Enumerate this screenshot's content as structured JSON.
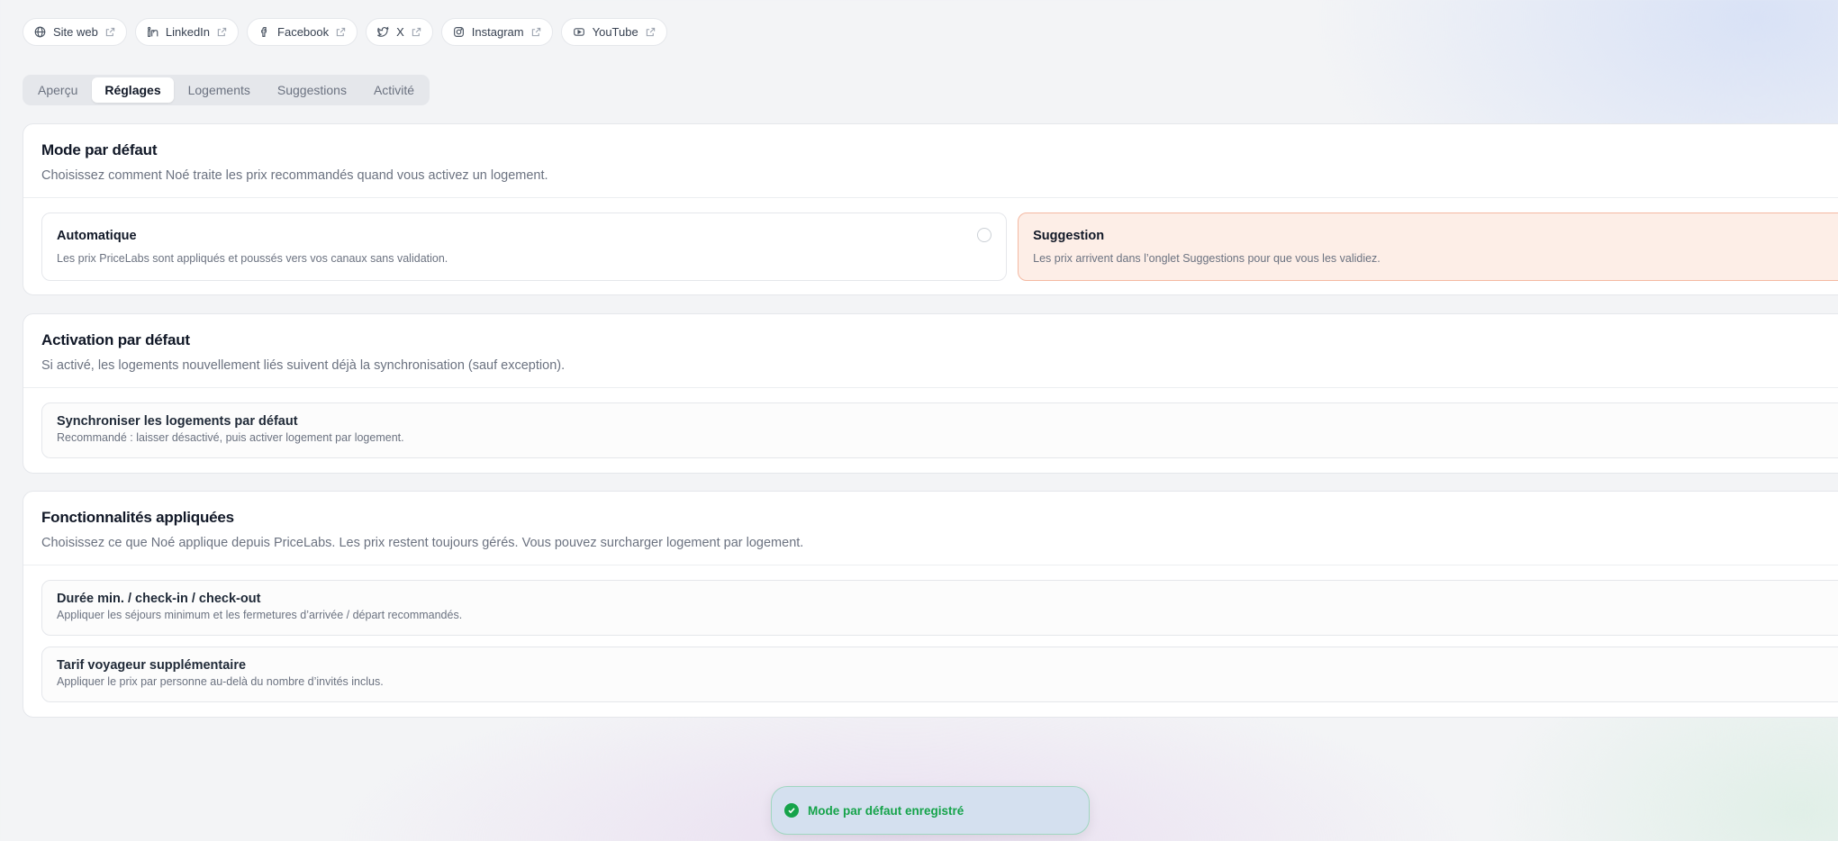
{
  "social_links": [
    {
      "label": "Site web",
      "icon": "globe-icon"
    },
    {
      "label": "LinkedIn",
      "icon": "linkedin-icon"
    },
    {
      "label": "Facebook",
      "icon": "facebook-icon"
    },
    {
      "label": "X",
      "icon": "x-twitter-icon"
    },
    {
      "label": "Instagram",
      "icon": "instagram-icon"
    },
    {
      "label": "YouTube",
      "icon": "youtube-icon"
    }
  ],
  "tabs": [
    {
      "label": "Aperçu"
    },
    {
      "label": "Réglages"
    },
    {
      "label": "Logements"
    },
    {
      "label": "Suggestions"
    },
    {
      "label": "Activité"
    }
  ],
  "active_tab": "Réglages",
  "default_mode": {
    "title": "Mode par défaut",
    "description": "Choisissez comment Noé traite les prix recommandés quand vous activez un logement.",
    "options": [
      {
        "title": "Automatique",
        "description": "Les prix PriceLabs sont appliqués et poussés vers vos canaux sans validation."
      },
      {
        "title": "Suggestion",
        "description": "Les prix arrivent dans l’onglet Suggestions pour que vous les validiez."
      }
    ],
    "selected": "Suggestion"
  },
  "default_activation": {
    "title": "Activation par défaut",
    "description": "Si activé, les logements nouvellement liés suivent déjà la synchronisation (sauf exception).",
    "setting": {
      "title": "Synchroniser les logements par défaut",
      "description": "Recommandé : laisser désactivé, puis activer logement par logement."
    }
  },
  "features": {
    "title": "Fonctionnalités appliquées",
    "description": "Choisissez ce que Noé applique depuis PriceLabs. Les prix restent toujours gérés. Vous pouvez surcharger logement par logement.",
    "items": [
      {
        "title": "Durée min. / check-in / check-out",
        "description": "Appliquer les séjours minimum et les fermetures d’arrivée / départ recommandés."
      },
      {
        "title": "Tarif voyageur supplémentaire",
        "description": "Appliquer le prix par personne au-delà du nombre d’invités inclus."
      }
    ]
  },
  "toast": {
    "message": "Mode par défaut enregistré",
    "icon": "check-circle-icon"
  },
  "colors": {
    "accent_selected_bg": "#fdeee7",
    "accent_selected_border": "#f4b9a2",
    "success": "#16a34a"
  }
}
